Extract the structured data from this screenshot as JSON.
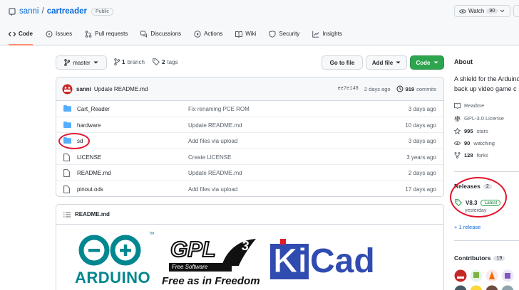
{
  "repo": {
    "owner": "sanni",
    "sep": "/",
    "name": "cartreader",
    "visibility": "Public"
  },
  "watch": {
    "label": "Watch",
    "count": "90"
  },
  "tabs": [
    {
      "label": "Code",
      "icon": "code-icon"
    },
    {
      "label": "Issues",
      "icon": "issue-icon"
    },
    {
      "label": "Pull requests",
      "icon": "pull-request-icon"
    },
    {
      "label": "Discussions",
      "icon": "discussion-icon"
    },
    {
      "label": "Actions",
      "icon": "play-icon"
    },
    {
      "label": "Wiki",
      "icon": "book-icon"
    },
    {
      "label": "Security",
      "icon": "shield-icon"
    },
    {
      "label": "Insights",
      "icon": "graph-icon"
    }
  ],
  "toolbar": {
    "branch": "master",
    "branch_count": "1",
    "branch_label": "branch",
    "tag_count": "2",
    "tag_label": "tags",
    "goto": "Go to file",
    "add_file": "Add file",
    "code": "Code"
  },
  "commit": {
    "author": "sanni",
    "message": "Update README.md",
    "sha": "ee7e148",
    "age": "2 days ago",
    "count": "919",
    "count_label": "commits"
  },
  "files": [
    {
      "type": "dir",
      "name": "Cart_Reader",
      "message": "Fix renaming PCE ROM",
      "age": "3 days ago"
    },
    {
      "type": "dir",
      "name": "hardware",
      "message": "Update README.md",
      "age": "10 days ago"
    },
    {
      "type": "dir",
      "name": "sd",
      "message": "Add files via upload",
      "age": "3 days ago"
    },
    {
      "type": "file",
      "name": "LICENSE",
      "message": "Create LICENSE",
      "age": "3 years ago"
    },
    {
      "type": "file",
      "name": "README.md",
      "message": "Update README.md",
      "age": "2 days ago"
    },
    {
      "type": "file",
      "name": "pinout.ods",
      "message": "Add files via upload",
      "age": "17 days ago"
    }
  ],
  "readme": {
    "title": "README.md",
    "logos": {
      "arduino": "ARDUINO",
      "gpl_top": "GPL",
      "gpl_num": "3",
      "gpl_sub": "Free Software",
      "gpl_slogan": "Free as in Freedom",
      "kicad_k": "Ki",
      "kicad_rest": "Cad",
      "tm": "TM"
    }
  },
  "sidebar": {
    "about_title": "About",
    "about_line1": "A shield for the Arduino",
    "about_line2": "back up video game c",
    "readme": "Readme",
    "license": "GPL-3.0 License",
    "stars_count": "995",
    "stars_label": "stars",
    "watching_count": "90",
    "watching_label": "watching",
    "forks_count": "128",
    "forks_label": "forks",
    "releases_title": "Releases",
    "releases_count": "2",
    "release_tag": "V8.3",
    "release_latest": "Latest",
    "release_date": "yesterday",
    "release_more": "+ 1 release",
    "contributors_title": "Contributors",
    "contributors_count": "19"
  },
  "colors": {
    "link": "#0969da",
    "green": "#2da44e",
    "highlight": "#e3132c",
    "folder": "#54aeff"
  }
}
